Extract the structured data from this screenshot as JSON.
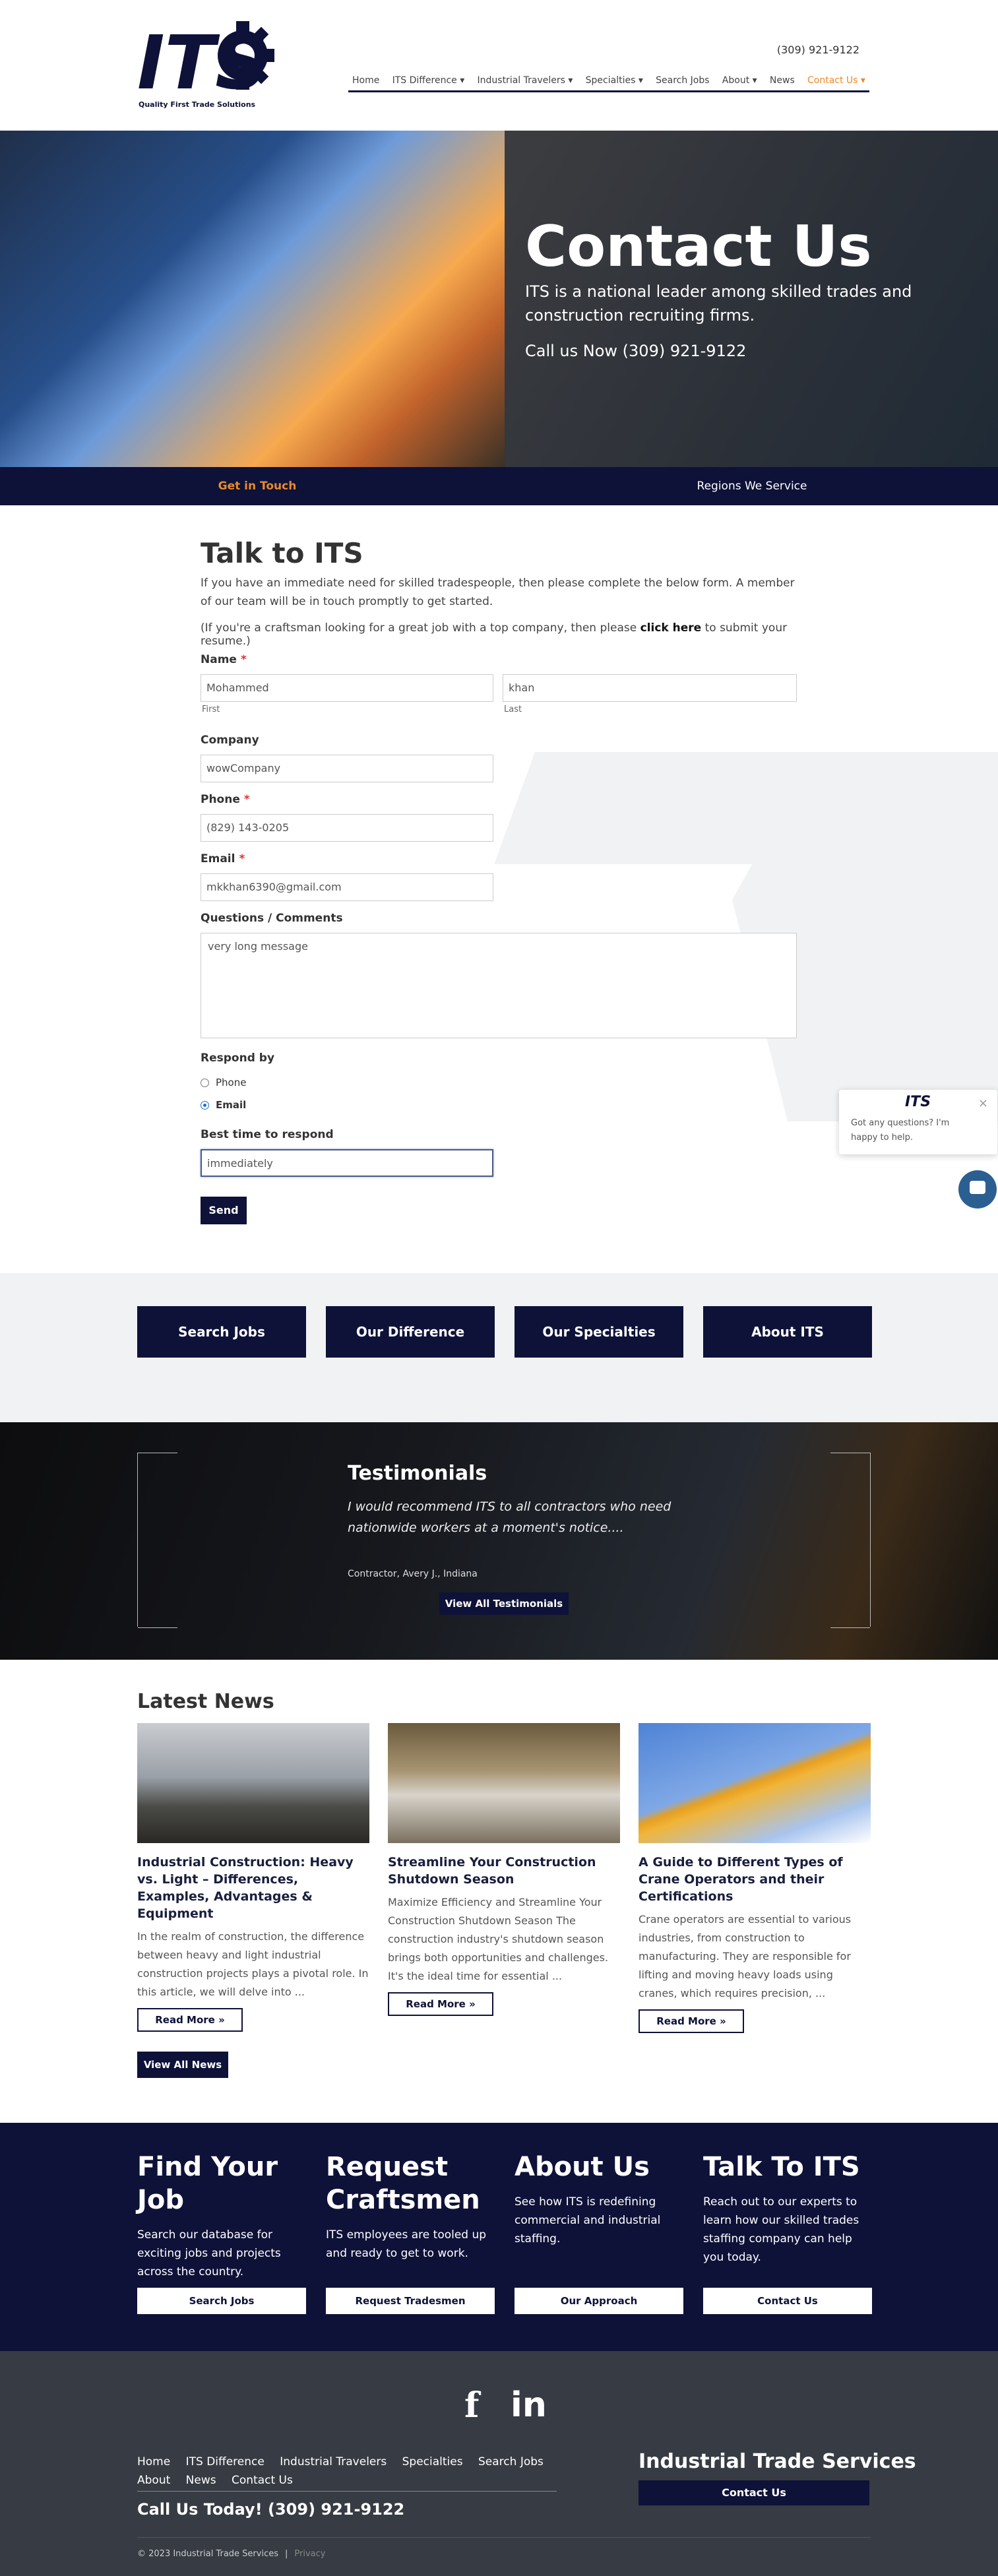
{
  "header": {
    "logo_text": "ITS",
    "logo_tagline": "Quality First Trade Solutions",
    "phone": "(309) 921-9122",
    "nav": [
      {
        "label": "Home"
      },
      {
        "label": "ITS Difference ▾"
      },
      {
        "label": "Industrial Travelers ▾"
      },
      {
        "label": "Specialties ▾"
      },
      {
        "label": "Search Jobs"
      },
      {
        "label": "About ▾"
      },
      {
        "label": "News"
      },
      {
        "label": "Contact Us ▾"
      }
    ],
    "active_nav": "Contact Us ▾"
  },
  "hero": {
    "title": "Contact Us",
    "lead": "ITS is a national leader among skilled trades and construction recruiting firms.",
    "call": "Call us Now (309) 921-9122"
  },
  "subtabs": {
    "tab1": "Get in Touch",
    "tab2": "Regions We Service"
  },
  "form": {
    "title": "Talk to ITS",
    "intro": "If you have an immediate need for skilled tradespeople, then please complete the below form. A member of our team will be in touch promptly to get started.",
    "craft_prefix": "(If you're a craftsman looking for a great job with a top company, then please ",
    "craft_link": "click here",
    "craft_suffix": " to submit your resume.)",
    "name_label": "Name",
    "first_value": "Mohammed",
    "first_label": "First",
    "last_value": "khan",
    "last_label": "Last",
    "company_label": "Company",
    "company_value": "wowCompany",
    "phone_label": "Phone",
    "phone_value": "(829) 143-0205",
    "email_label": "Email",
    "email_value": "mkkhan6390@gmail.com",
    "comments_label": "Questions / Comments",
    "comments_value": "very long message",
    "respond_label": "Respond by",
    "respond_options": [
      "Phone",
      "Email"
    ],
    "respond_selected": "Email",
    "best_time_label": "Best time to respond",
    "best_time_value": "immediately",
    "required_mark": "*",
    "send_label": "Send"
  },
  "chat": {
    "logo": "ITS",
    "message": "Got any questions? I'm happy to help.",
    "close": "×"
  },
  "quick_links": [
    "Search Jobs",
    "Our Difference",
    "Our Specialties",
    "About ITS"
  ],
  "testimonials": {
    "title": "Testimonials",
    "quote": "I would recommend ITS to all contractors who need nationwide workers at a moment's notice....",
    "author": "Contractor, Avery J., Indiana",
    "button": "View All Testimonials"
  },
  "news": {
    "title": "Latest News",
    "items": [
      {
        "title": "Industrial Construction: Heavy vs. Light – Differences, Examples, Advantages & Equipment",
        "excerpt": "In the realm of construction, the difference between heavy and light industrial construction projects plays a pivotal role. In this article, we will delve into ...",
        "more": "Read More »"
      },
      {
        "title": "Streamline Your Construction Shutdown Season",
        "excerpt": "Maximize Efficiency and Streamline Your Construction Shutdown Season   The construction industry's shutdown season brings both opportunities and challenges. It's the ideal time for essential ...",
        "more": "Read More »"
      },
      {
        "title": "A Guide to Different Types of Crane Operators and their Certifications",
        "excerpt": "Crane operators are essential to various industries, from construction to manufacturing. They are responsible for lifting and moving heavy loads using cranes, which requires precision, ...",
        "more": "Read More »"
      }
    ],
    "view_all": "View All News"
  },
  "cta": [
    {
      "title": "Find Your Job",
      "text": "Search our database for exciting jobs and projects across the country.",
      "button": "Search Jobs"
    },
    {
      "title": "Request Craftsmen",
      "text": "ITS employees are tooled up and ready to get to work.",
      "button": "Request Tradesmen"
    },
    {
      "title": "About Us",
      "text": "See how ITS is redefining commercial and industrial staffing.",
      "button": "Our Approach"
    },
    {
      "title": "Talk To ITS",
      "text": "Reach out to our experts to learn how our skilled trades staffing company can help you today.",
      "button": "Contact Us"
    }
  ],
  "footer": {
    "social": [
      "f",
      "in"
    ],
    "links_row1": [
      "Home",
      "ITS Difference",
      "Industrial Travelers",
      "Specialties",
      "Search Jobs"
    ],
    "links_row2": [
      "About",
      "News",
      "Contact Us"
    ],
    "call": "Call Us Today! (309) 921-9122",
    "brand": "Industrial Trade Services",
    "contact_button": "Contact Us",
    "copyright": "© 2023 Industrial Trade Services",
    "separator": "|",
    "privacy": "Privacy"
  },
  "colors": {
    "navy": "#0e1238",
    "accent": "#e98a2c",
    "footer": "#373b43"
  }
}
